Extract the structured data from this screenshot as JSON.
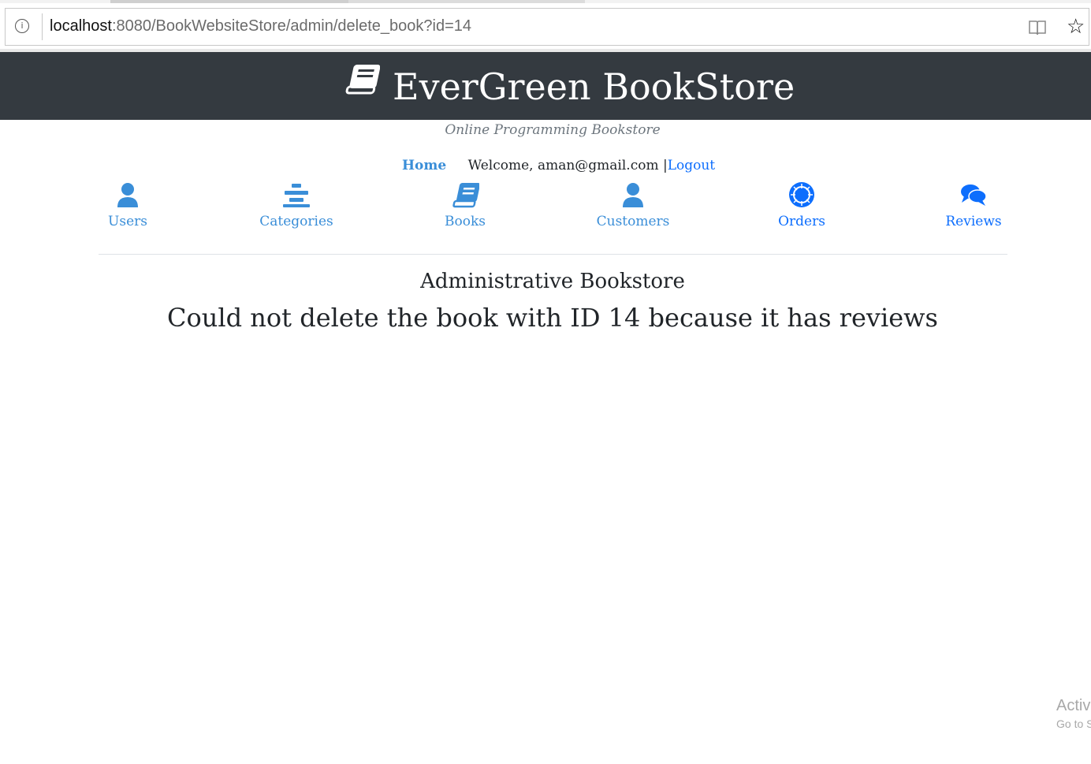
{
  "browser": {
    "url_host": "localhost",
    "url_rest": ":8080/BookWebsiteStore/admin/delete_book?id=14",
    "icons": [
      "info-icon",
      "reader-view-icon",
      "star-icon"
    ]
  },
  "header": {
    "title": "EverGreen BookStore",
    "tagline": "Online Programming Bookstore",
    "logo_icon": "book-icon",
    "background": "#343a40"
  },
  "topnav": {
    "home_label": "Home",
    "welcome_text": "Welcome, aman@gmail.com |",
    "logout_label": "Logout"
  },
  "menu": {
    "items": [
      {
        "label": "Users",
        "icon": "user-icon"
      },
      {
        "label": "Categories",
        "icon": "list-icon"
      },
      {
        "label": "Books",
        "icon": "book-icon"
      },
      {
        "label": "Customers",
        "icon": "user-icon"
      },
      {
        "label": "Orders",
        "icon": "orders-icon"
      },
      {
        "label": "Reviews",
        "icon": "comments-icon"
      }
    ],
    "accent": "#3a8ed8",
    "active_accent": "#0d6efd"
  },
  "main": {
    "heading": "Administrative Bookstore",
    "message": "Could not delete the book with ID 14 because it has reviews"
  },
  "watermark": {
    "line1": "Activ",
    "line2": "Go to S"
  }
}
